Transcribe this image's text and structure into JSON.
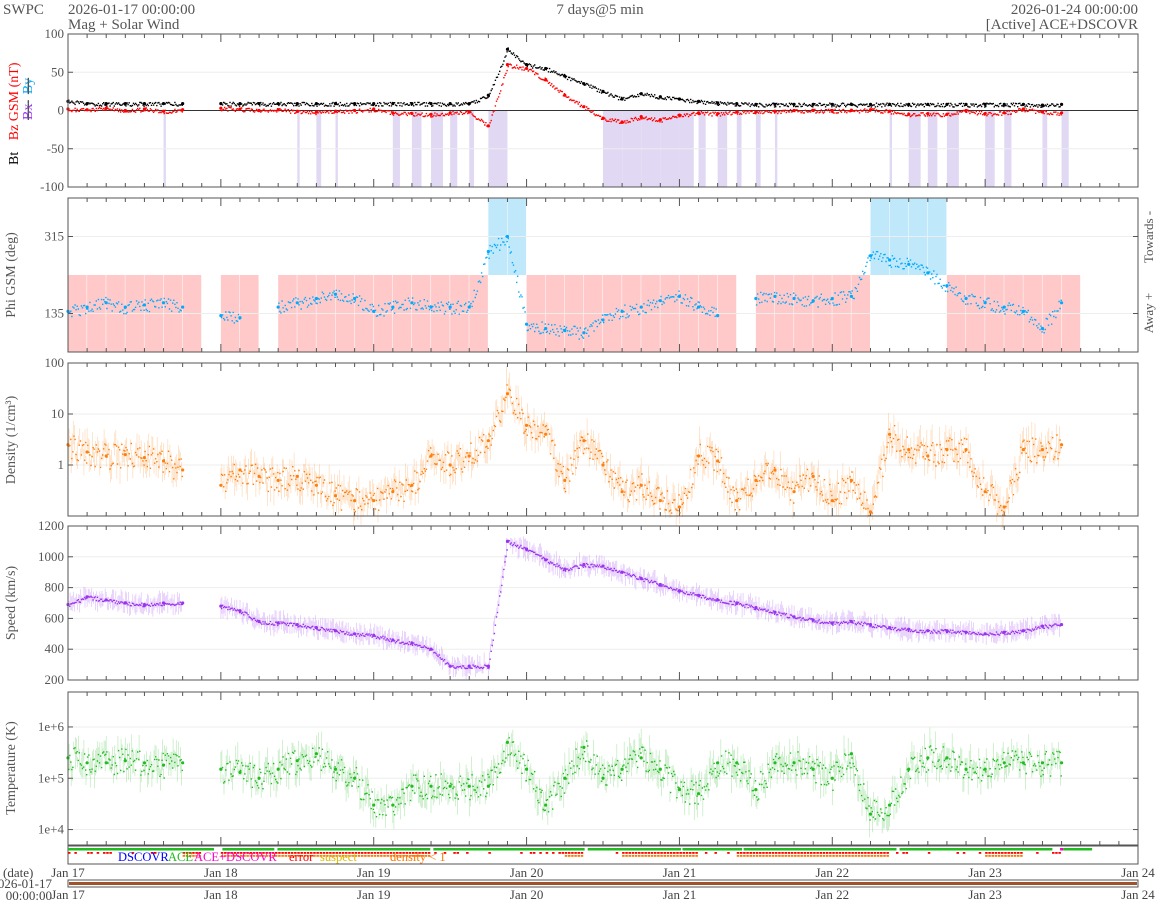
{
  "header": {
    "org": "SWPC",
    "start": "2026-01-17 00:00:00",
    "subtitle": "Mag + Solar Wind",
    "span": "7 days@5 min",
    "end": "2026-01-24 00:00:00",
    "source": "[Active] ACE+DSCOVR"
  },
  "colors": {
    "bt": "#000000",
    "bz": "#ff0000",
    "bx": "#9933ff",
    "by": "#00aaff",
    "bz_neg_fill": "#d9cff0",
    "away_fill": "#ffc9c9",
    "towards_fill": "#bfe8fa",
    "density": "#ff7f0e",
    "speed": "#9933ee",
    "temperature": "#22bb22",
    "ace": "#22bb22",
    "dscovr": "#0000ff",
    "both": "#ff00cc",
    "error": "#ff0000",
    "suspect": "#ddbb00",
    "dens_flag": "#ff7700",
    "date_bar": "#a0522d"
  },
  "chart_data": [
    {
      "type": "scatter",
      "id": "mag",
      "ylabel_parts": [
        "Bt",
        "Bz GSM (nT)",
        "Bx",
        "By"
      ],
      "ylim": [
        -100,
        100
      ],
      "yticks": [
        "100",
        "50",
        "0",
        "-50",
        "-100"
      ],
      "ytick_values": [
        100,
        50,
        0,
        -50,
        -100
      ],
      "x_step_hours": 3,
      "series": [
        {
          "name": "Bt",
          "values": [
            12,
            9,
            9,
            9,
            9,
            9,
            9,
            null,
            9,
            9,
            9,
            9,
            9,
            9,
            9,
            9,
            9,
            9,
            9,
            9,
            9,
            9,
            20,
            80,
            60,
            55,
            45,
            35,
            25,
            15,
            22,
            18,
            15,
            12,
            10,
            9,
            8,
            8,
            8,
            8,
            8,
            8,
            8,
            8,
            8,
            8,
            8,
            8,
            8,
            8,
            8,
            7,
            8
          ]
        },
        {
          "name": "Bz",
          "values": [
            2,
            1,
            3,
            0,
            2,
            -1,
            1,
            null,
            3,
            2,
            0,
            1,
            -1,
            -2,
            -1,
            0,
            2,
            -3,
            -4,
            -5,
            -3,
            -2,
            -20,
            60,
            55,
            40,
            20,
            5,
            -10,
            -15,
            -8,
            -12,
            -6,
            -3,
            -4,
            -2,
            -2,
            -1,
            0,
            0,
            0,
            0,
            1,
            -1,
            -5,
            -4,
            -5,
            0,
            -4,
            -3,
            2,
            -2,
            -3
          ]
        }
      ]
    },
    {
      "type": "scatter",
      "id": "phi",
      "ylabel": "Phi GSM (deg)",
      "right_labels": [
        "Towards -",
        "Away +"
      ],
      "ylim": [
        45,
        405
      ],
      "yticks": [
        "315",
        "135"
      ],
      "ytick_values": [
        315,
        135
      ],
      "sector_boundary": 225,
      "x_step_hours": 3,
      "values": [
        140,
        150,
        160,
        150,
        155,
        160,
        150,
        null,
        130,
        125,
        null,
        150,
        160,
        170,
        180,
        170,
        140,
        150,
        160,
        150,
        150,
        150,
        280,
        315,
        110,
        100,
        95,
        90,
        120,
        140,
        150,
        165,
        175,
        150,
        130,
        null,
        170,
        175,
        170,
        165,
        170,
        175,
        270,
        260,
        250,
        230,
        200,
        170,
        160,
        150,
        140,
        100,
        160
      ]
    },
    {
      "type": "scatter",
      "id": "density",
      "ylabel": "Density (1/cm³)",
      "yscale": "log",
      "ylim": [
        0.1,
        100
      ],
      "yticks": [
        "100",
        "10",
        "1"
      ],
      "ytick_values": [
        100,
        10,
        1
      ],
      "x_step_hours": 3,
      "values": [
        2.5,
        1.8,
        1.5,
        1.6,
        1.4,
        1.2,
        0.8,
        null,
        0.4,
        0.8,
        0.6,
        0.5,
        0.6,
        0.4,
        0.25,
        0.2,
        0.2,
        0.3,
        0.4,
        1.5,
        1.0,
        1.5,
        3,
        25,
        6,
        4,
        0.5,
        3,
        1,
        0.3,
        0.4,
        0.2,
        0.15,
        1.5,
        1.2,
        0.2,
        0.5,
        0.8,
        0.3,
        0.6,
        0.2,
        0.5,
        0.12,
        4,
        2,
        1.5,
        2,
        2,
        0.3,
        0.15,
        2,
        2,
        2.5
      ]
    },
    {
      "type": "scatter",
      "id": "speed",
      "ylabel": "Speed (km/s)",
      "ylim": [
        200,
        1200
      ],
      "yticks": [
        "1200",
        "1000",
        "800",
        "600",
        "400",
        "200"
      ],
      "ytick_values": [
        1200,
        1000,
        800,
        600,
        400,
        200
      ],
      "x_step_hours": 3,
      "values": [
        690,
        740,
        720,
        700,
        690,
        700,
        700,
        null,
        680,
        650,
        580,
        570,
        560,
        540,
        520,
        500,
        490,
        460,
        440,
        400,
        290,
        290,
        290,
        1100,
        1050,
        980,
        920,
        950,
        940,
        900,
        860,
        820,
        780,
        750,
        720,
        700,
        670,
        640,
        610,
        590,
        570,
        580,
        560,
        540,
        530,
        520,
        520,
        510,
        500,
        510,
        520,
        550,
        560
      ]
    },
    {
      "type": "scatter",
      "id": "temperature",
      "ylabel": "Temperature (K)",
      "yscale": "log",
      "ylim": [
        5000,
        4800000
      ],
      "yticks": [
        "1e+6",
        "1e+5",
        "1e+4"
      ],
      "ytick_values": [
        1000000,
        100000,
        10000
      ],
      "x_step_hours": 3,
      "values": [
        250000,
        200000,
        200000,
        220000,
        200000,
        180000,
        200000,
        null,
        150000,
        130000,
        100000,
        150000,
        220000,
        300000,
        150000,
        100000,
        30000,
        30000,
        70000,
        70000,
        70000,
        70000,
        70000,
        500000,
        150000,
        30000,
        100000,
        400000,
        100000,
        150000,
        250000,
        150000,
        60000,
        50000,
        200000,
        200000,
        60000,
        200000,
        200000,
        150000,
        100000,
        300000,
        20000,
        30000,
        150000,
        250000,
        250000,
        150000,
        150000,
        200000,
        200000,
        200000,
        200000
      ]
    }
  ],
  "xaxis": {
    "ticks": [
      "Jan 17",
      "Jan 18",
      "Jan 19",
      "Jan 20",
      "Jan 21",
      "Jan 22",
      "Jan 23",
      "Jan 24"
    ],
    "date_label": "(date)",
    "date_start": "2026-01-17",
    "time_start": "00:00:00"
  },
  "status": {
    "legend": [
      "DSCOVR",
      "ACE",
      "ACE+DSCOVR",
      "error",
      "suspect",
      "density < 1"
    ],
    "ace_segments_days": [
      [
        0,
        0.955
      ],
      [
        1.01,
        1.35
      ],
      [
        1.37,
        2.37
      ],
      [
        2.39,
        3.38
      ],
      [
        3.4,
        4.01
      ],
      [
        4.02,
        4.41
      ],
      [
        4.42,
        5.42
      ],
      [
        5.44,
        6.44
      ],
      [
        6.51,
        6.7
      ]
    ],
    "both_segments_days": [
      [
        6.49,
        6.51
      ]
    ]
  }
}
